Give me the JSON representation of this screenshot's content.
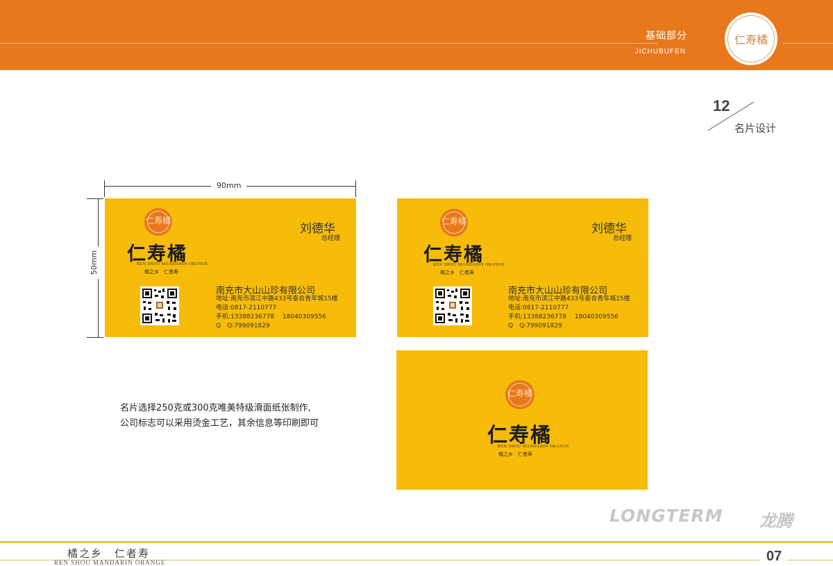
{
  "header": {
    "section_title": "基础部分",
    "section_subtitle": "JICHUBUFEN",
    "seal_text": "仁寿橘"
  },
  "page": {
    "number": "12",
    "subtitle": "名片设计",
    "footer_page": "07"
  },
  "dimensions": {
    "width_label": "90mm",
    "height_label": "50mm"
  },
  "card": {
    "seal_text": "仁寿橘",
    "brand_name": "仁寿橘",
    "brand_en": "REN SHOU MANDARIN ORANGE",
    "brand_tagline": "橘之乡　仁者寿",
    "person_name": "刘德华",
    "person_title": "总经理",
    "company": "南充市大山山珍有限公司",
    "address": "地址:南充市滨江中路433号泰合青年城15楼",
    "phone": "电话:0817-2110777",
    "mobile": "手机:13388236778　 18040309556",
    "qq": "Q　Q:799091829"
  },
  "description": {
    "line1": "名片选择250克或300克唯美特级滑面纸张制作,",
    "line2": "公司标志可以采用烫金工艺，其余信息等印刷即可"
  },
  "watermark": {
    "logo_text": "LONGTERM",
    "logo_cn": "龙腾"
  },
  "footer": {
    "slogan_cn": "橘之乡　仁者寿",
    "slogan_en": "REN SHOU MANDARIN ORANGE"
  },
  "colors": {
    "header_orange": "#e8781c",
    "card_yellow": "#f7bc0a",
    "footer_gold": "#e8c44a"
  }
}
